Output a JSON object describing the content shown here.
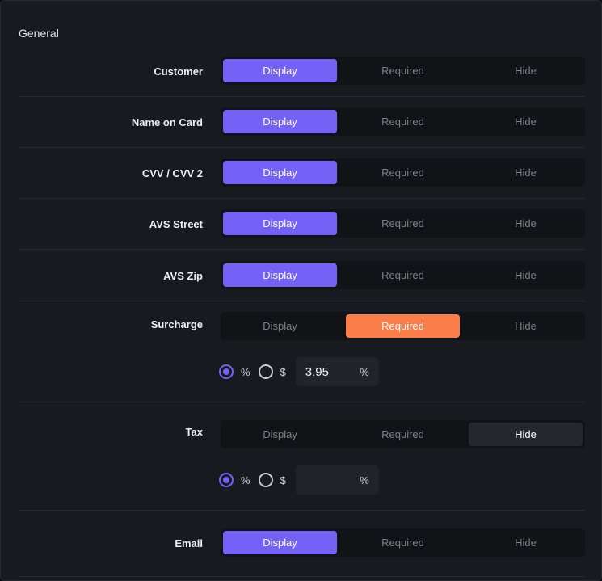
{
  "section": {
    "title": "General"
  },
  "fields": [
    {
      "label": "Customer",
      "selected": "Display"
    },
    {
      "label": "Name on Card",
      "selected": "Display"
    },
    {
      "label": "CVV / CVV 2",
      "selected": "Display"
    },
    {
      "label": "AVS Street",
      "selected": "Display"
    },
    {
      "label": "AVS Zip",
      "selected": "Display"
    },
    {
      "label": "Surcharge",
      "selected": "Required",
      "mode": "%",
      "amount": "3.95",
      "unit": "%"
    },
    {
      "label": "Tax",
      "selected": "Hide",
      "mode": "%",
      "amount": "",
      "unit": "%"
    },
    {
      "label": "Email",
      "selected": "Display"
    }
  ],
  "options": {
    "display": "Display",
    "required": "Required",
    "hide": "Hide"
  },
  "modes": {
    "percent": "%",
    "dollar": "$"
  },
  "colors": {
    "display_active": "#7461f6",
    "required_active": "#fb7e4a",
    "hide_active": "#24282d"
  }
}
